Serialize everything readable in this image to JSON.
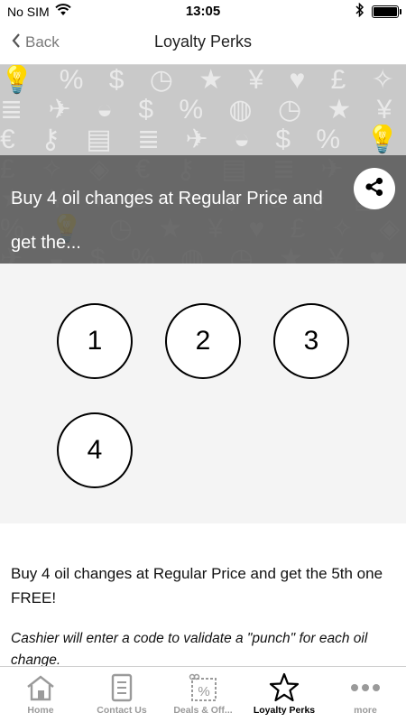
{
  "status_bar": {
    "carrier": "No SIM",
    "time": "13:05",
    "icons": [
      "wifi-icon",
      "bluetooth-icon",
      "battery-icon"
    ],
    "battery_level": 1.0
  },
  "nav": {
    "back_label": "Back",
    "title": "Loyalty Perks"
  },
  "hero": {
    "text": "Buy 4 oil changes at Regular Price and get the...",
    "pattern_icons": [
      "lightbulb-icon",
      "percent-icon",
      "dollar-icon",
      "clock-icon",
      "star-icon",
      "yen-icon",
      "heart-icon",
      "pound-icon",
      "magic-wand-icon",
      "tag-icon",
      "euro-icon",
      "key-icon",
      "briefcase-icon",
      "coins-icon",
      "paper-plane-icon",
      "piggy-bank-icon"
    ],
    "share_icon": "share-icon"
  },
  "punch_card": {
    "punches": [
      "1",
      "2",
      "3",
      "4"
    ]
  },
  "description": {
    "main": "Buy 4 oil changes at Regular Price and get the 5th one FREE!",
    "note": "Cashier will enter a code to validate a \"punch\" for each oil change."
  },
  "tabs": [
    {
      "label": "Home",
      "icon": "home-icon",
      "active": false
    },
    {
      "label": "Contact Us",
      "icon": "contact-card-icon",
      "active": false
    },
    {
      "label": "Deals & Off...",
      "icon": "coupon-icon",
      "active": false
    },
    {
      "label": "Loyalty Perks",
      "icon": "star-icon",
      "active": true
    },
    {
      "label": "more",
      "icon": "more-dots-icon",
      "active": false
    }
  ],
  "colors": {
    "hero_background": "#c9c9c9",
    "hero_band": "#5a5a5a",
    "punch_background": "#f4f4f4",
    "tab_inactive": "#9a9a9a",
    "tab_active": "#000000"
  }
}
